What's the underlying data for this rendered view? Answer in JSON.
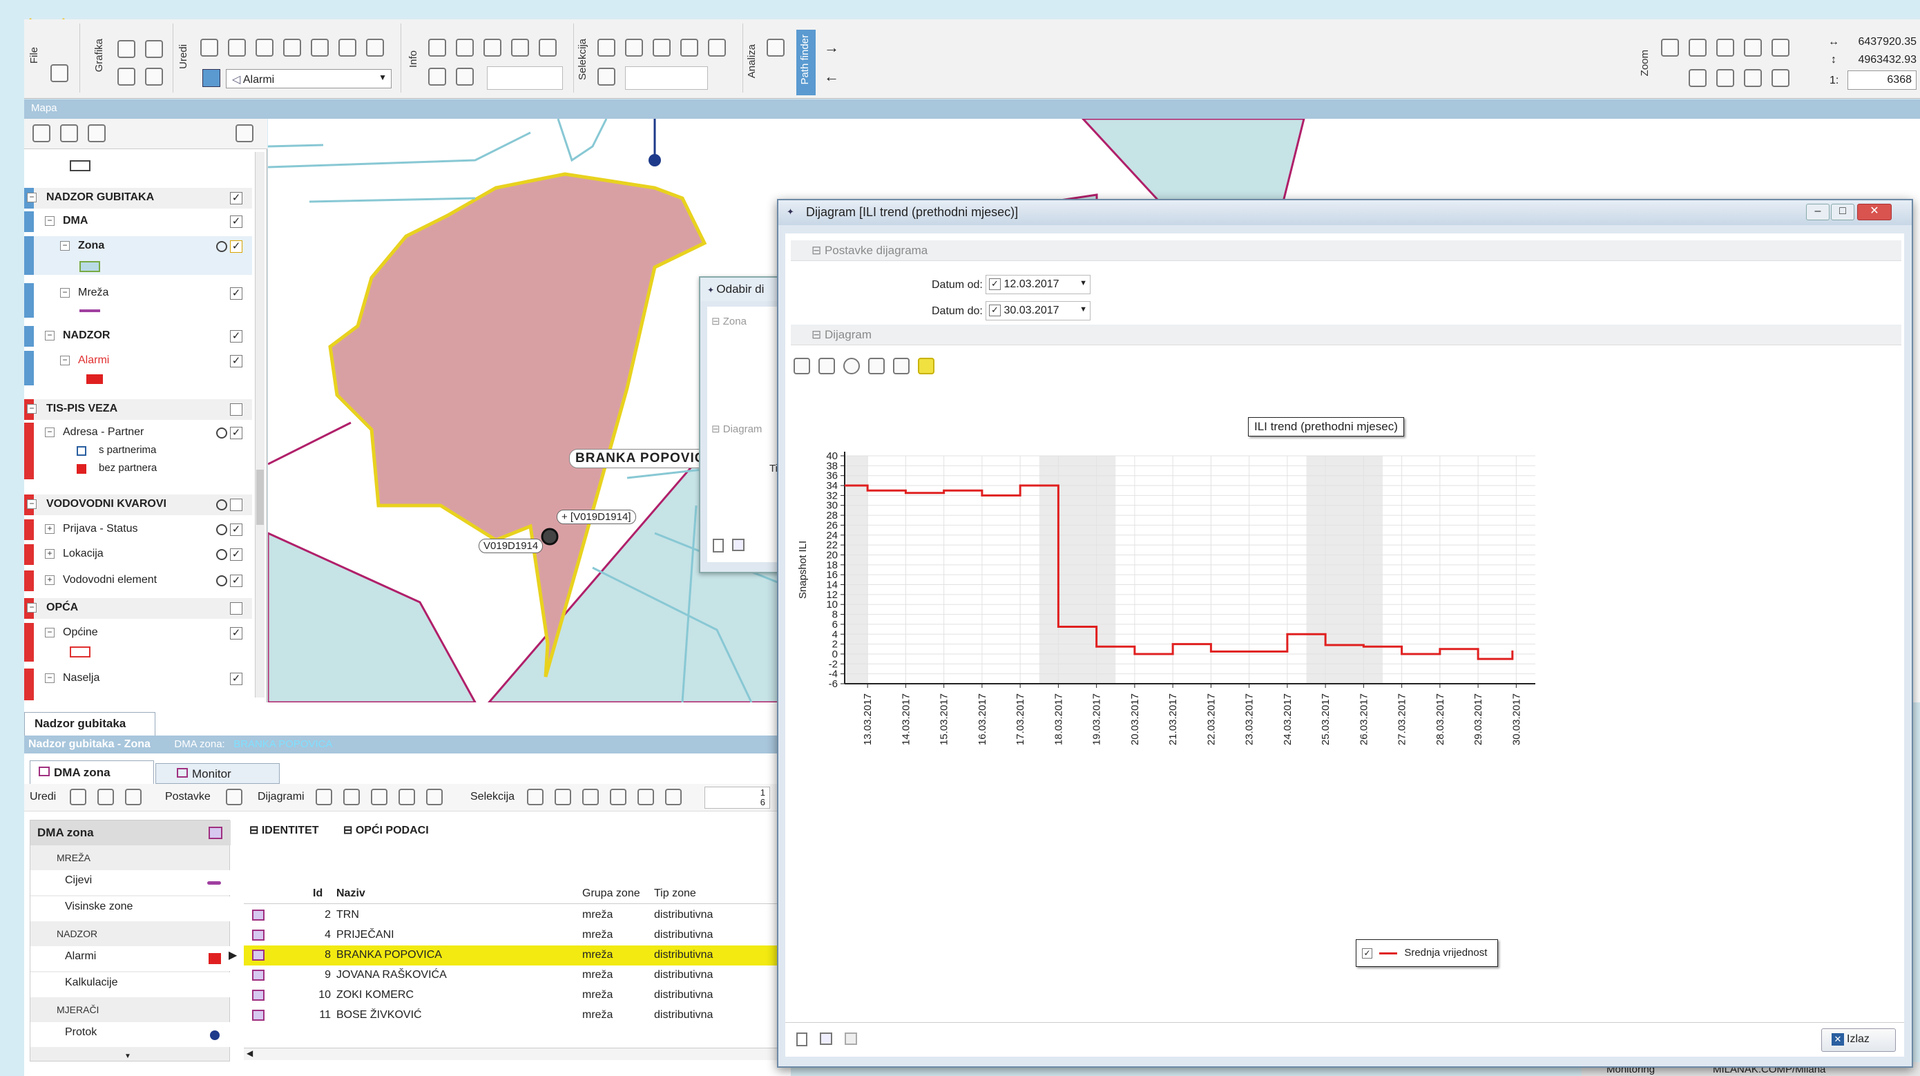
{
  "toolbar": {
    "groups": [
      "File",
      "Grafika",
      "Uredi",
      "Info",
      "Selekcija",
      "Analiza",
      "Path finder",
      "Zoom"
    ],
    "layer_select": "Alarmi",
    "coord_x": "6437920.35",
    "coord_y": "4963432.93",
    "scale_prefix": "1:",
    "scale": "6368"
  },
  "map_panel_title": "Mapa",
  "layers": [
    {
      "label": "NADZOR GUBITAKA",
      "checked": "✓"
    },
    {
      "label": "DMA",
      "checked": "✓"
    },
    {
      "label": "Zona",
      "checked": "✓"
    },
    {
      "label": "Mreža",
      "checked": "✓"
    },
    {
      "label": "NADZOR",
      "checked": "✓"
    },
    {
      "label": "Alarmi",
      "checked": "✓"
    },
    {
      "label": "TIS-PIS VEZA",
      "checked": ""
    },
    {
      "label": "Adresa - Partner",
      "checked": "✓"
    },
    {
      "label": "s partnerima",
      "checked": ""
    },
    {
      "label": "bez partnera",
      "checked": ""
    },
    {
      "label": "VODOVODNI KVAROVI",
      "checked": ""
    },
    {
      "label": "Prijava - Status",
      "checked": "✓"
    },
    {
      "label": "Lokacija",
      "checked": "✓"
    },
    {
      "label": "Vodovodni element",
      "checked": "✓"
    },
    {
      "label": "OPĆA",
      "checked": ""
    },
    {
      "label": "Općine",
      "checked": "✓"
    },
    {
      "label": "Naselja",
      "checked": "✓"
    }
  ],
  "map": {
    "zone_label": "BRANKA POPOVICA",
    "node_label_1": "+ [V019D1914]",
    "node_label_2": "V019D1914"
  },
  "behind_dialog": {
    "title": "Odabir di",
    "zona": "Zona",
    "diagram": "Diagram",
    "tip": "Tip"
  },
  "bottom": {
    "tab_main": "Nadzor gubitaka",
    "breadcrumb": "Nadzor gubitaka - Zona",
    "breadcrumb_extra_label": "DMA zona:",
    "breadcrumb_extra_value": "BRANKA POPOVICA",
    "tab_dma": "DMA zona",
    "tab_monitor": "Monitor",
    "toolbar_labels": [
      "Uredi",
      "Postavke",
      "Dijagrami",
      "Selekcija"
    ],
    "page_top": "1",
    "page_bottom": "6",
    "side_title": "DMA zona",
    "side_items": [
      {
        "label": "MREŽA",
        "type": "cat"
      },
      {
        "label": "Cijevi",
        "type": "item"
      },
      {
        "label": "Visinske zone",
        "type": "item"
      },
      {
        "label": "NADZOR",
        "type": "cat"
      },
      {
        "label": "Alarmi",
        "type": "item"
      },
      {
        "label": "Kalkulacije",
        "type": "item"
      },
      {
        "label": "MJERAČI",
        "type": "cat"
      },
      {
        "label": "Protok",
        "type": "item"
      }
    ],
    "group_identitet": "IDENTITET",
    "group_opci": "OPĆI PODACI",
    "columns": [
      "Id",
      "Naziv",
      "Grupa zone",
      "Tip zone"
    ],
    "rows": [
      {
        "id": "2",
        "naziv": "TRN",
        "grupa": "mreža",
        "tip": "distributivna"
      },
      {
        "id": "4",
        "naziv": "PRIJEČANI",
        "grupa": "mreža",
        "tip": "distributivna"
      },
      {
        "id": "8",
        "naziv": "BRANKA POPOVICA",
        "grupa": "mreža",
        "tip": "distributivna"
      },
      {
        "id": "9",
        "naziv": "JOVANA RAŠKOVIĆA",
        "grupa": "mreža",
        "tip": "distributivna"
      },
      {
        "id": "10",
        "naziv": "ZOKI KOMERC",
        "grupa": "mreža",
        "tip": "distributivna"
      },
      {
        "id": "11",
        "naziv": "BOSE ŽIVKOVIĆ",
        "grupa": "mreža",
        "tip": "distributivna"
      }
    ],
    "status_1": "Monitoring",
    "status_2": "MILANAK.COMP/Milana"
  },
  "dialog": {
    "title": "Dijagram [ILI trend (prethodni mjesec)]",
    "section_settings": "Postavke dijagrama",
    "datum_od_label": "Datum od:",
    "datum_od": "12.03.2017",
    "datum_do_label": "Datum do:",
    "datum_do": "30.03.2017",
    "section_diagram": "Dijagram",
    "exit_label": "Izlaz"
  },
  "chart_data": {
    "type": "line",
    "title": "ILI trend (prethodni mjesec)",
    "ylabel": "Snapshot ILI",
    "xlabel": "",
    "ylim": [
      -6,
      40
    ],
    "yticks": [
      40,
      38,
      36,
      34,
      32,
      30,
      28,
      26,
      24,
      22,
      20,
      18,
      16,
      14,
      12,
      10,
      8,
      6,
      4,
      2,
      0,
      -2,
      -4,
      -6
    ],
    "x_labels": [
      "13.03.2017",
      "14.03.2017",
      "15.03.2017",
      "16.03.2017",
      "17.03.2017",
      "18.03.2017",
      "19.03.2017",
      "20.03.2017",
      "21.03.2017",
      "22.03.2017",
      "23.03.2017",
      "24.03.2017",
      "25.03.2017",
      "26.03.2017",
      "27.03.2017",
      "28.03.2017",
      "29.03.2017",
      "30.03.2017"
    ],
    "shaded_ranges": [
      [
        -0.6,
        0
      ],
      [
        4.5,
        6.5
      ],
      [
        11.5,
        13.5
      ]
    ],
    "series": [
      {
        "name": "Srednja vrijednost",
        "color": "#e02020",
        "step_x": [
          -0.6,
          0,
          1,
          2,
          3,
          4,
          5,
          5.4,
          6,
          7,
          8,
          9,
          10,
          11,
          12,
          13,
          14,
          15,
          16,
          16.9
        ],
        "step_y": [
          34,
          33,
          32.5,
          33,
          32,
          34,
          5.5,
          5.5,
          1.5,
          0,
          2,
          0.5,
          0.5,
          4,
          1.8,
          1.5,
          0,
          1,
          -1,
          0.7
        ]
      }
    ],
    "grid": true,
    "legend": "bottom-center"
  }
}
